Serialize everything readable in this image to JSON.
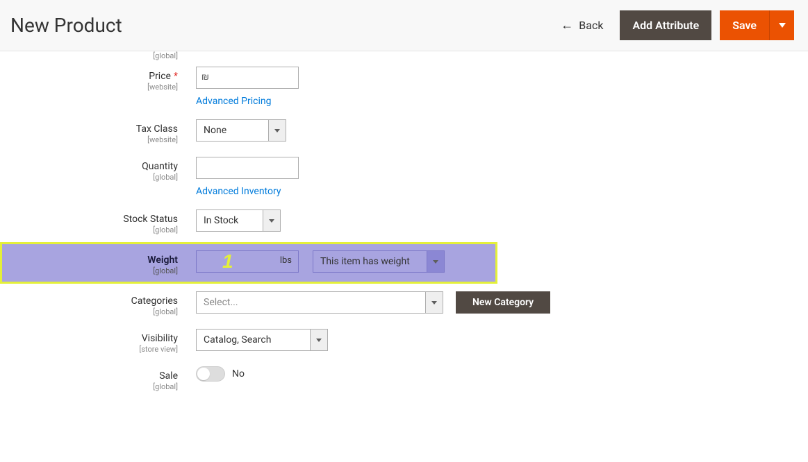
{
  "header": {
    "title": "New Product",
    "back": "Back",
    "addAttribute": "Add Attribute",
    "save": "Save"
  },
  "fields": {
    "topScope": "[global]",
    "price": {
      "label": "Price",
      "scope": "[website]",
      "currency": "₪",
      "value": "",
      "advanced": "Advanced Pricing"
    },
    "taxClass": {
      "label": "Tax Class",
      "scope": "[website]",
      "value": "None"
    },
    "quantity": {
      "label": "Quantity",
      "scope": "[global]",
      "value": "",
      "advanced": "Advanced Inventory"
    },
    "stockStatus": {
      "label": "Stock Status",
      "scope": "[global]",
      "value": "In Stock"
    },
    "weight": {
      "label": "Weight",
      "scope": "[global]",
      "unit": "lbs",
      "value": "",
      "option": "This item has weight",
      "annotation": "1"
    },
    "categories": {
      "label": "Categories",
      "scope": "[global]",
      "placeholder": "Select...",
      "newBtn": "New Category"
    },
    "visibility": {
      "label": "Visibility",
      "scope": "[store view]",
      "value": "Catalog, Search"
    },
    "sale": {
      "label": "Sale",
      "scope": "[global]",
      "value": "No"
    }
  }
}
